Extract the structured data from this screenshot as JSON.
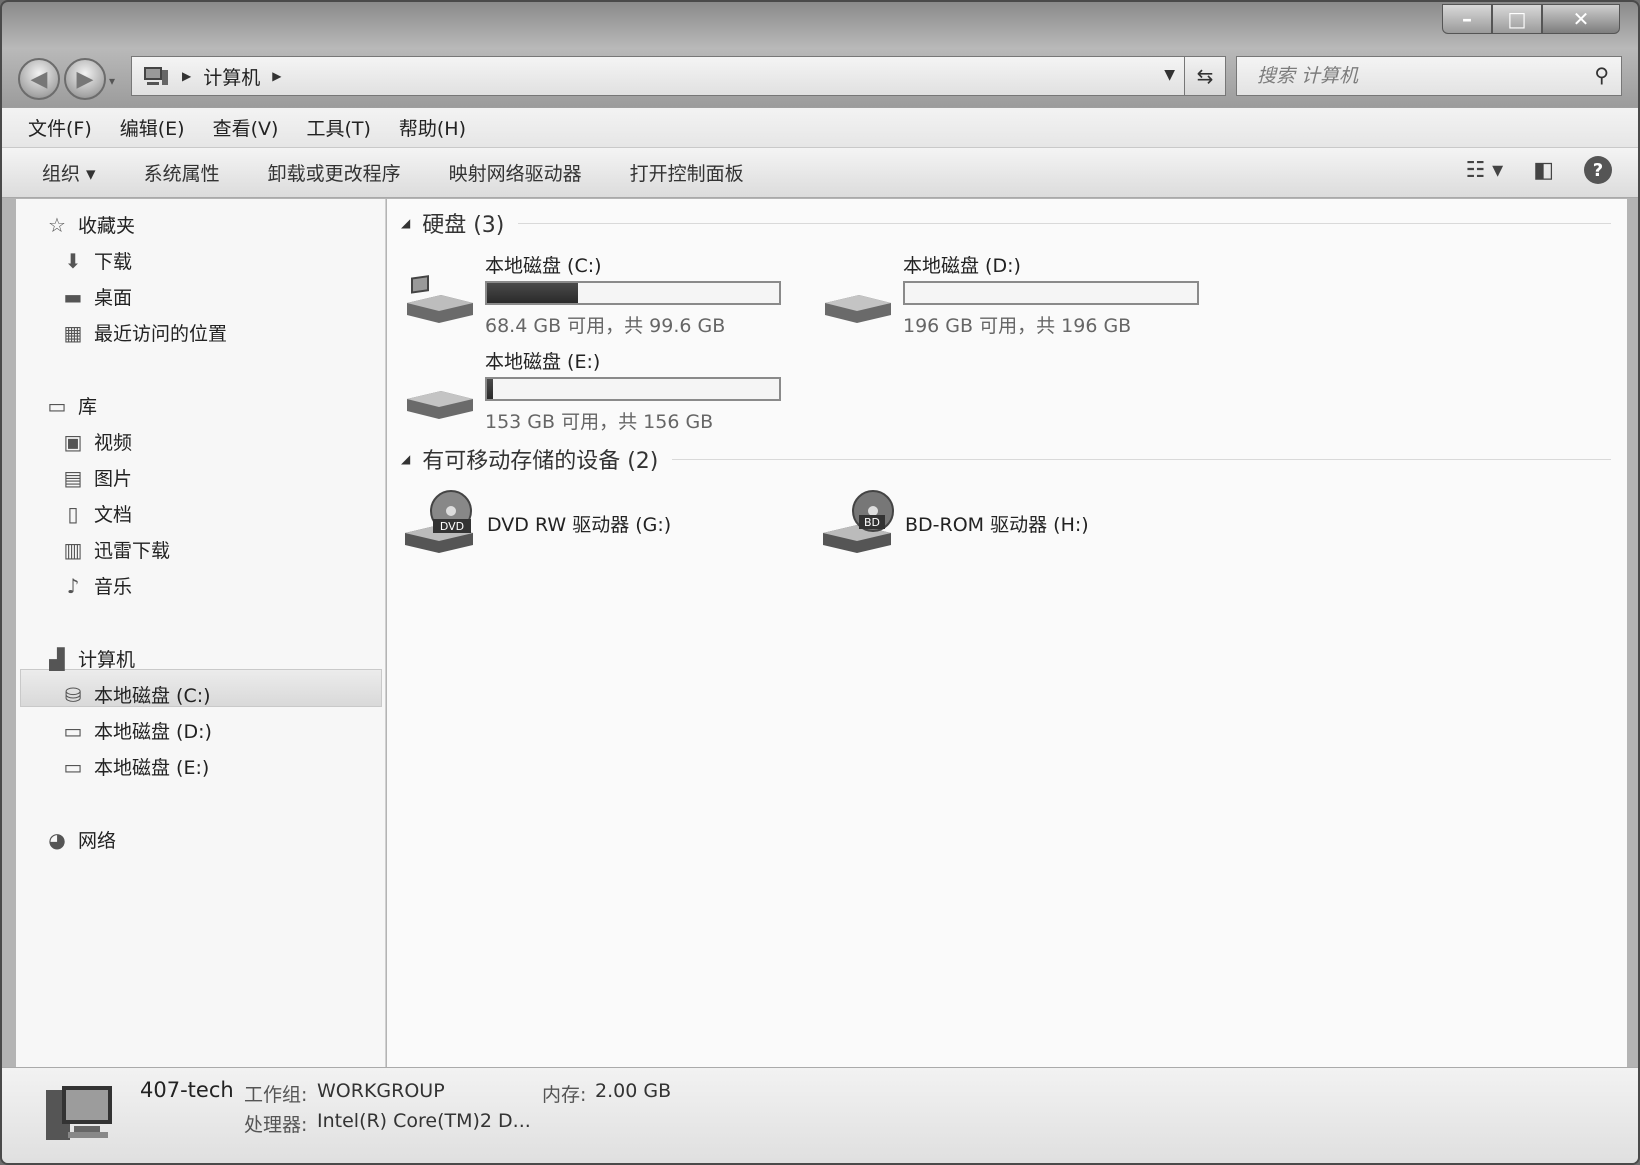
{
  "address": {
    "crumbs": [
      "计算机"
    ],
    "search_placeholder": "搜索 计算机"
  },
  "menu": [
    "文件(F)",
    "编辑(E)",
    "查看(V)",
    "工具(T)",
    "帮助(H)"
  ],
  "commands": {
    "organize": "组织 ▾",
    "items": [
      "系统属性",
      "卸载或更改程序",
      "映射网络驱动器",
      "打开控制面板"
    ]
  },
  "nav": {
    "favorites": "收藏夹",
    "fav_items": [
      "下载",
      "桌面",
      "最近访问的位置"
    ],
    "libraries": "库",
    "lib_items": [
      "视频",
      "图片",
      "文档",
      "迅雷下载",
      "音乐"
    ],
    "computer": "计算机",
    "computer_items": [
      "本地磁盘 (C:)",
      "本地磁盘 (D:)",
      "本地磁盘 (E:)"
    ],
    "network": "网络"
  },
  "groups": {
    "hard_disks": "硬盘 (3)",
    "removable": "有可移动存储的设备 (2)"
  },
  "drives": [
    {
      "name": "本地磁盘 (C:)",
      "free": "68.4 GB 可用，共 99.6 GB",
      "used_fraction": 0.313
    },
    {
      "name": "本地磁盘 (D:)",
      "free": "196 GB 可用，共 196 GB",
      "used_fraction": 0.0
    },
    {
      "name": "本地磁盘 (E:)",
      "free": "153 GB 可用，共 156 GB",
      "used_fraction": 0.02
    }
  ],
  "devices": [
    {
      "name": "DVD RW 驱动器 (G:)",
      "badge": "DVD"
    },
    {
      "name": "BD-ROM 驱动器 (H:)",
      "badge": "BD"
    }
  ],
  "details": {
    "host": "407-tech",
    "workgroup_label": "工作组:",
    "workgroup": "WORKGROUP",
    "memory_label": "内存:",
    "memory": "2.00 GB",
    "cpu_label": "处理器:",
    "cpu": "Intel(R) Core(TM)2 D..."
  }
}
